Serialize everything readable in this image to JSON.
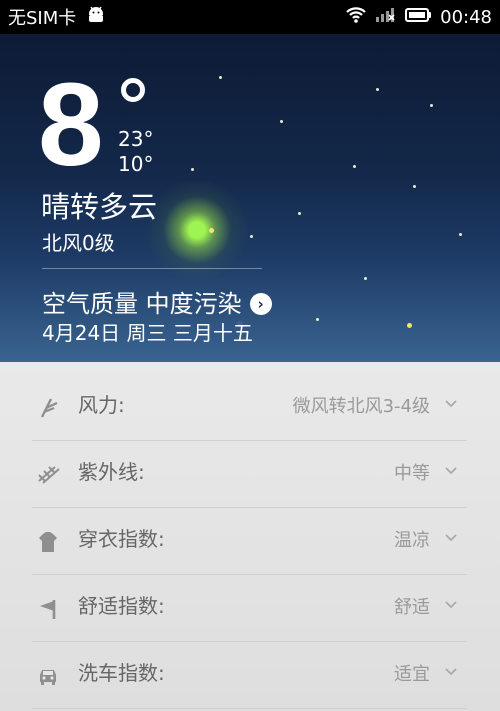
{
  "status_bar": {
    "carrier": "无SIM卡",
    "time": "00:48",
    "icons": [
      "android-icon",
      "wifi-icon",
      "signal-off-icon",
      "battery-icon"
    ]
  },
  "current_weather": {
    "temperature": "8",
    "high": "23°",
    "low": "10°",
    "condition": "晴转多云",
    "wind": "北风0级",
    "air_quality": "空气质量  中度污染",
    "date": "4月24日 周三 三月十五"
  },
  "details": [
    {
      "label": "风力:",
      "value": "微风转北风3-4级",
      "icon": "wind-icon"
    },
    {
      "label": "紫外线:",
      "value": "中等",
      "icon": "uv-icon"
    },
    {
      "label": "穿衣指数:",
      "value": "温凉",
      "icon": "clothing-icon"
    },
    {
      "label": "舒适指数:",
      "value": "舒适",
      "icon": "comfort-icon"
    },
    {
      "label": "洗车指数:",
      "value": "适宜",
      "icon": "car-wash-icon"
    }
  ],
  "colors": {
    "hero_top": "#0d1b35",
    "hero_bottom": "#3a6490",
    "list_bg": "#e9e9e9",
    "highlight_green": "#a5ff50"
  }
}
